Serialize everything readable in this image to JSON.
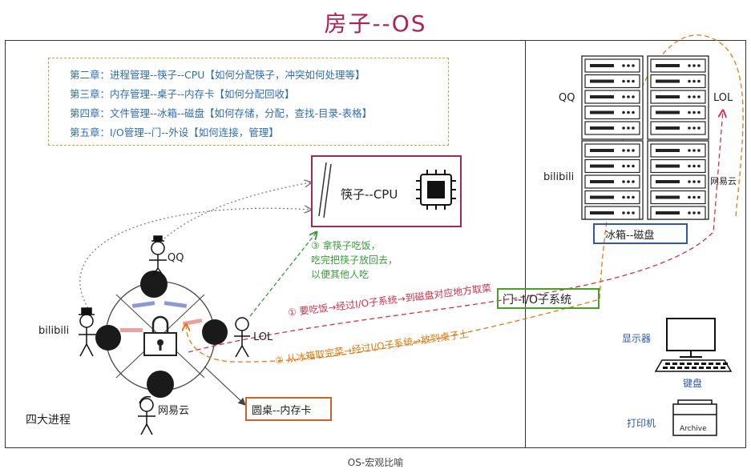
{
  "title": "房子--OS",
  "chapters": [
    "第二章：进程管理--筷子--CPU【如何分配筷子，冲突如何处理等】",
    "第三章：内存管理--桌子--内存卡【如何分配回收】",
    "第四章：文件管理--冰箱--磁盘【如何存储，分配，查找-目录-表格】",
    "第五章：I/O管理--门--外设【如何连接，管理】"
  ],
  "cpu_label": "筷子--CPU",
  "memory_label": "圆桌--内存卡",
  "door_label": "门--I/O子系统",
  "fridge_label": "冰箱--磁盘",
  "processes": {
    "qq": "QQ",
    "bilibili": "bilibili",
    "lol": "LOL",
    "netease": "网易云"
  },
  "group_label": "四大进程",
  "step3": [
    "③ 拿筷子吃饭，",
    "吃完把筷子放回去，",
    "以便其他人吃"
  ],
  "step1": "① 要吃饭→经过I/O子系统→到磁盘对应地方取菜",
  "step2": "② 从冰箱取完菜→经过I/O子系统→放到桌子上",
  "server_labels": {
    "qq": "QQ",
    "lol": "LOL",
    "bilibili": "bilibili",
    "netease": "网易云"
  },
  "devices": {
    "monitor": "显示器",
    "keyboard": "键盘",
    "printer": "打印机",
    "archive": "Archive"
  },
  "caption": "OS-宏观比喻",
  "colors": {
    "title": "#b0205a",
    "chapters_text": "#2f6db3",
    "step1": "#d0304a",
    "step2": "#e07a10",
    "step3": "#3a9a3a",
    "door": "#4f9a2a",
    "fridge": "#2f55b5"
  }
}
